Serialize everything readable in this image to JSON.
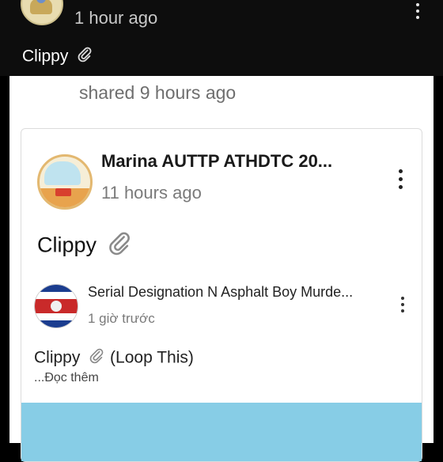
{
  "top_post": {
    "time": "1 hour ago",
    "text": "Clippy",
    "clip_icon": "paperclip-icon"
  },
  "share": {
    "label": "shared 9 hours ago"
  },
  "card": {
    "author": "Marina AUTTP ATHDTC 20...",
    "time": "11 hours ago",
    "text": "Clippy",
    "clip_icon": "paperclip-icon"
  },
  "inner_post": {
    "author": "Serial Designation N Asphalt Boy Murde...",
    "time": "1 giờ trước",
    "text": "Clippy",
    "text_suffix": "(Loop This)",
    "read_more": "...Đọc thêm",
    "clip_icon": "paperclip-icon"
  },
  "colors": {
    "top_bg": "#0d0d0d",
    "media_bg": "#87cde6"
  }
}
